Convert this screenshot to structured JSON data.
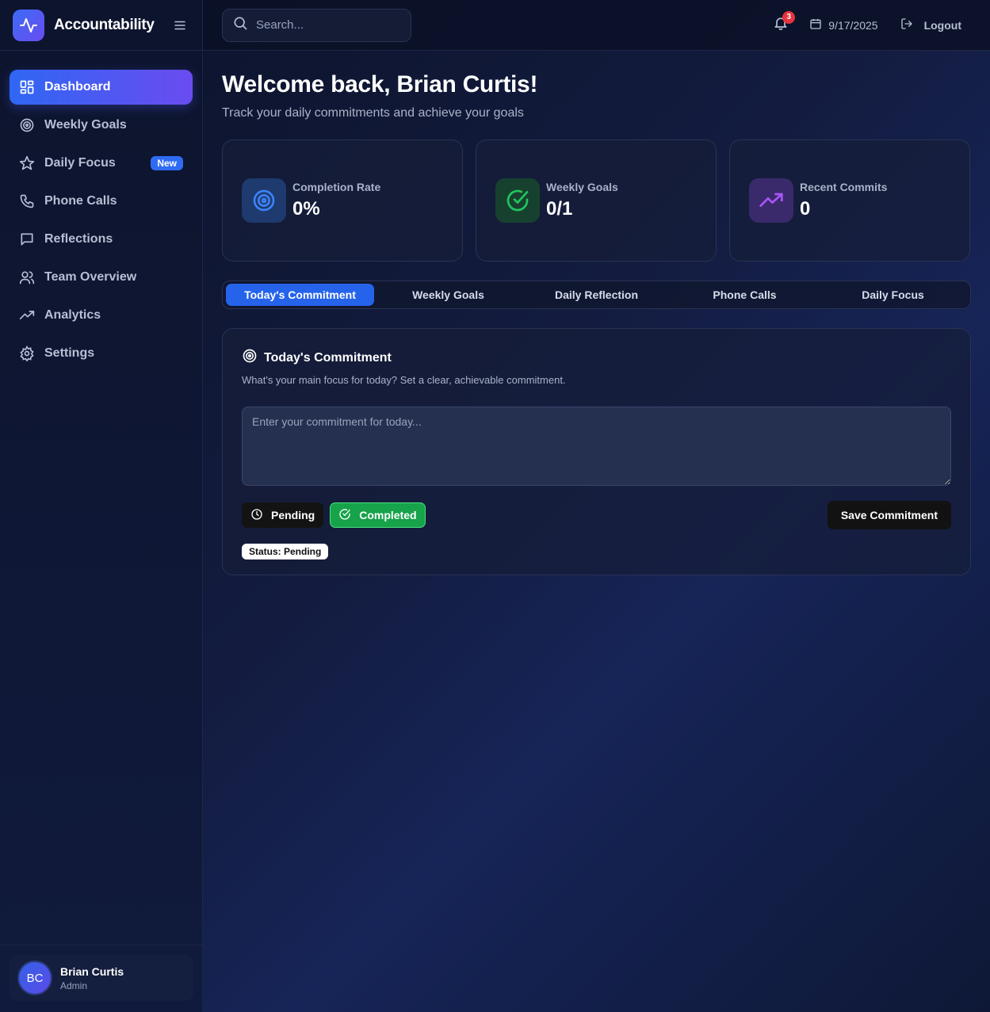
{
  "brand": {
    "name": "Accountability"
  },
  "sidebar": {
    "items": [
      {
        "label": "Dashboard",
        "icon": "dashboard-icon"
      },
      {
        "label": "Weekly Goals",
        "icon": "target-icon"
      },
      {
        "label": "Daily Focus",
        "icon": "star-icon",
        "badge": "New"
      },
      {
        "label": "Phone Calls",
        "icon": "phone-icon"
      },
      {
        "label": "Reflections",
        "icon": "chat-icon"
      },
      {
        "label": "Team Overview",
        "icon": "users-icon"
      },
      {
        "label": "Analytics",
        "icon": "trend-icon"
      },
      {
        "label": "Settings",
        "icon": "gear-icon"
      }
    ],
    "user": {
      "initials": "BC",
      "name": "Brian Curtis",
      "role": "Admin"
    }
  },
  "header": {
    "search_placeholder": "Search...",
    "notifications": "3",
    "date": "9/17/2025",
    "logout": "Logout"
  },
  "main": {
    "welcome": "Welcome back, Brian Curtis!",
    "subtitle": "Track your daily commitments and achieve your goals",
    "stats": [
      {
        "label": "Completion Rate",
        "value": "0%",
        "icon": "target-icon",
        "color": "#3b82f6"
      },
      {
        "label": "Weekly Goals",
        "value": "0/1",
        "icon": "check-circle-icon",
        "color": "#22c55e"
      },
      {
        "label": "Recent Commits",
        "value": "0",
        "icon": "trend-icon",
        "color": "#a855f7"
      }
    ],
    "tabs": [
      "Today's Commitment",
      "Weekly Goals",
      "Daily Reflection",
      "Phone Calls",
      "Daily Focus"
    ],
    "panel": {
      "title": "Today's Commitment",
      "description": "What's your main focus for today? Set a clear, achievable commitment.",
      "input_placeholder": "Enter your commitment for today...",
      "pending_label": "Pending",
      "completed_label": "Completed",
      "save_label": "Save Commitment",
      "status": "Status: Pending"
    }
  },
  "colors": {
    "accent": "#2563eb",
    "success": "#16a34a",
    "danger": "#e5343f"
  }
}
